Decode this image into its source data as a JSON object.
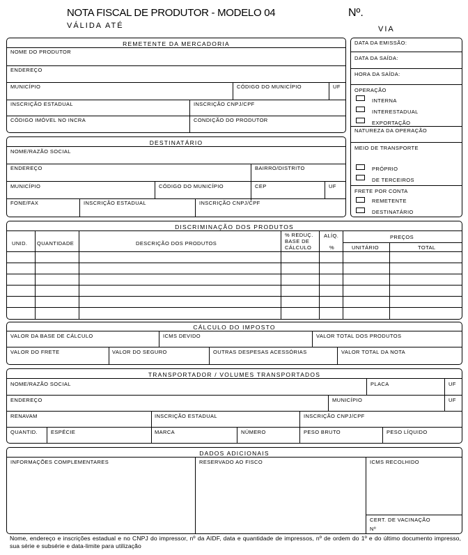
{
  "header": {
    "title": "NOTA FISCAL DE PRODUTOR - MODELO 04",
    "validity": "VÁLIDA ATÉ",
    "number_label": "Nº.",
    "via_label": "VIA"
  },
  "remetente": {
    "title": "REMETENTE DA MERCADORIA",
    "nome_produtor": "NOME DO PRODUTOR",
    "endereco": "ENDEREÇO",
    "municipio": "MUNICÍPIO",
    "codigo_municipio": "CÓDIGO DO MUNICÍPIO",
    "uf": "UF",
    "inscricao_estadual": "INSCRIÇÃO ESTADUAL",
    "inscricao_cnpj": "INSCRIÇÃO CNPJ/CPF",
    "codigo_imovel": "CÓDIGO IMÓVEL NO INCRA",
    "condicao_produtor": "CONDIÇÃO DO PRODUTOR"
  },
  "side": {
    "data_emissao": "DATA DA EMISSÃO:",
    "data_saida": "DATA DA SAÍDA:",
    "hora_saida": "HORA DA SAÍDA:",
    "operacao": "OPERAÇÃO",
    "interna": "INTERNA",
    "interestadual": "INTERESTADUAL",
    "exportacao": "EXPORTAÇÃO",
    "natureza": "NATUREZA DA OPERAÇÃO",
    "meio_transporte": "MEIO DE TRANSPORTE",
    "proprio": "PRÓPRIO",
    "terceiros": "DE TERCEIROS",
    "frete_conta": "FRETE POR CONTA",
    "remetente": "REMETENTE",
    "destinatario": "DESTINATÁRIO"
  },
  "destinatario": {
    "title": "DESTINATÁRIO",
    "nome": "NOME/RAZÃO SOCIAL",
    "endereco": "ENDEREÇO",
    "bairro": "BAIRRO/DISTRITO",
    "municipio": "MUNICÍPIO",
    "codigo_municipio": "CÓDIGO DO MUNICÍPIO",
    "cep": "CEP",
    "uf": "UF",
    "fone": "FONE/FAX",
    "inscricao_estadual": "INSCRIÇÃO ESTADUAL",
    "inscricao_cnpj": "INSCRIÇÃO CNPJ/CPF"
  },
  "discriminacao": {
    "title": "DISCRIMINAÇÃO DOS PRODUTOS",
    "unid": "UNID.",
    "quantidade": "QUANTIDADE",
    "descricao": "DESCRIÇÃO DOS PRODUTOS",
    "reduc_1": "% REDUÇ.",
    "reduc_2": "BASE DE",
    "reduc_3": "CÁLCULO",
    "aliq": "ALÍQ.",
    "aliq_pct": "%",
    "precos": "PREÇOS",
    "unitario": "UNITÁRIO",
    "total": "TOTAL"
  },
  "calculo": {
    "title": "CÁLCULO DO IMPOSTO",
    "base_calculo": "VALOR DA BASE DE CÁLCULO",
    "icms_devido": "ICMS DEVIDO",
    "total_produtos": "VALOR TOTAL DOS PRODUTOS",
    "frete": "VALOR DO FRETE",
    "seguro": "VALOR DO SEGURO",
    "outras": "OUTRAS DESPESAS ACESSÓRIAS",
    "total_nota": "VALOR TOTAL DA NOTA"
  },
  "transportador": {
    "title": "TRANSPORTADOR / VOLUMES TRANSPORTADOS",
    "nome": "NOME/RAZÃO SOCIAL",
    "placa": "PLACA",
    "uf1": "UF",
    "endereco": "ENDEREÇO",
    "municipio": "MUNICÍPIO",
    "uf2": "UF",
    "renavam": "RENAVAM",
    "inscricao_estadual": "INSCRIÇÃO ESTADUAL",
    "inscricao_cnpj": "INSCRIÇÃO CNPJ/CPF",
    "quantid": "QUANTID.",
    "especie": "ESPÉCIE",
    "marca": "MARCA",
    "numero": "NÚMERO",
    "peso_bruto": "PESO BRUTO",
    "peso_liquido": "PESO LÍQUIDO"
  },
  "adicionais": {
    "title": "DADOS ADICIONAIS",
    "informacoes": "INFORMAÇÕES COMPLEMENTARES",
    "reservado": "RESERVADO AO FISCO",
    "icms_recolhido": "ICMS RECOLHIDO",
    "cert_vacinacao": "CERT. DE VACINAÇÃO",
    "numero": "Nº"
  },
  "footer": "Nome, endereço e inscrições estadual e no CNPJ do impressor, nº da AIDF, data e quantidade de impressos, nº de ordem do 1º e do último documento impresso, sua série e subsérie e data-limite para utilização"
}
